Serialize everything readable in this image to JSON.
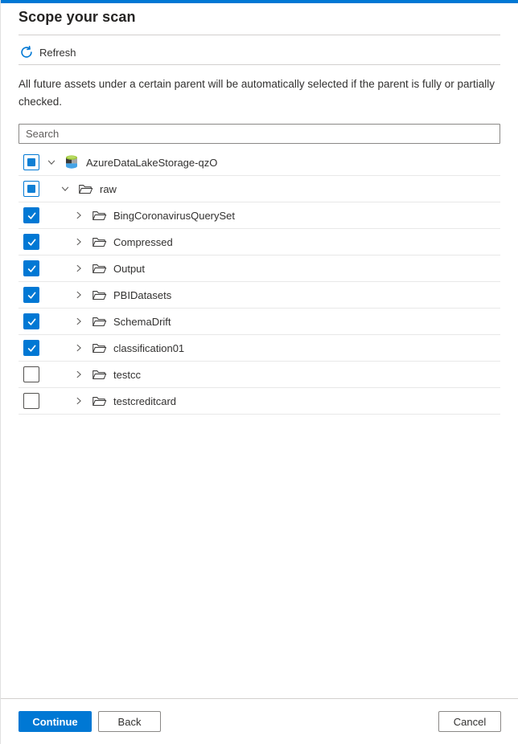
{
  "panel": {
    "title": "Scope your scan"
  },
  "toolbar": {
    "refresh_label": "Refresh"
  },
  "description": "All future assets under a certain parent will be automatically selected if the parent is fully or partially checked.",
  "search": {
    "placeholder": "Search"
  },
  "tree": {
    "items": [
      {
        "label": "AzureDataLakeStorage-qzO",
        "level": 0,
        "checkbox": "indeterminate",
        "expanded": true,
        "icon": "data-lake-storage-icon"
      },
      {
        "label": "raw",
        "level": 1,
        "checkbox": "indeterminate",
        "expanded": true,
        "icon": "folder-icon"
      },
      {
        "label": "BingCoronavirusQuerySet",
        "level": 2,
        "checkbox": "checked",
        "expanded": false,
        "icon": "folder-icon"
      },
      {
        "label": "Compressed",
        "level": 2,
        "checkbox": "checked",
        "expanded": false,
        "icon": "folder-icon"
      },
      {
        "label": "Output",
        "level": 2,
        "checkbox": "checked",
        "expanded": false,
        "icon": "folder-icon"
      },
      {
        "label": "PBIDatasets",
        "level": 2,
        "checkbox": "checked",
        "expanded": false,
        "icon": "folder-icon"
      },
      {
        "label": "SchemaDrift",
        "level": 2,
        "checkbox": "checked",
        "expanded": false,
        "icon": "folder-icon"
      },
      {
        "label": "classification01",
        "level": 2,
        "checkbox": "checked",
        "expanded": false,
        "icon": "folder-icon"
      },
      {
        "label": "testcc",
        "level": 2,
        "checkbox": "unchecked",
        "expanded": false,
        "icon": "folder-icon"
      },
      {
        "label": "testcreditcard",
        "level": 2,
        "checkbox": "unchecked",
        "expanded": false,
        "icon": "folder-icon"
      }
    ]
  },
  "footer": {
    "continue_label": "Continue",
    "back_label": "Back",
    "cancel_label": "Cancel"
  },
  "colors": {
    "accent": "#0078d4",
    "checkbox_checked": "#0078d4",
    "row_divider": "#e8e8e8",
    "folder_green": "#a0ca3c",
    "folder_blue": "#45a3e6"
  }
}
